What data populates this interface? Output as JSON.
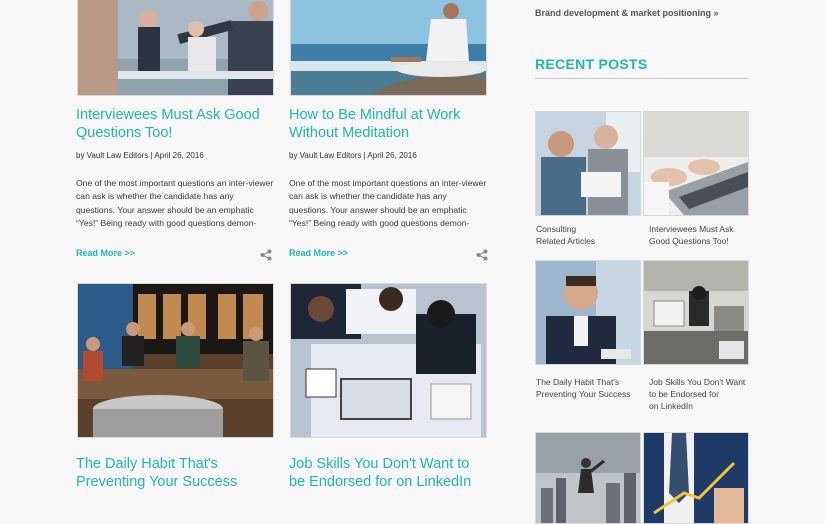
{
  "sidebar": {
    "top_link": "Brand development & market positioning »",
    "recent_heading": "RECENT POSTS",
    "recent_posts": [
      {
        "caption": "Consulting\nRelated Articles"
      },
      {
        "caption": "Interviewees Must Ask\nGood Questions Too!"
      },
      {
        "caption": "The Daily Habit That's\nPreventing Your Success"
      },
      {
        "caption": "Job Skills You Don't Want\nto be Endorsed for\non LinkedIn"
      }
    ]
  },
  "articles": [
    {
      "title": "Interviewees Must Ask Good Questions Too!",
      "byline": "by Vault Law Editors | April 26, 2016",
      "excerpt": "One of the most important questions an inter-viewer can ask is whether the candidate has any questions. Your answer should be an emphatic “Yes!” Being ready with good questions demon-",
      "read_more": "Read More >>"
    },
    {
      "title": "How to Be Mindful at Work Without Meditation",
      "byline": "by Vault Law Editors | April 26, 2016",
      "excerpt": "One of the most important questions an inter-viewer can ask is whether the candidate has any questions. Your answer should be an emphatic “Yes!” Being ready with good questions demon-",
      "read_more": "Read More >>"
    },
    {
      "title": "The Daily Habit That's Preventing Your Success"
    },
    {
      "title": "Job Skills You Don't Want to be Endorsed for on LinkedIn"
    }
  ],
  "icons": {
    "share": "share-icon"
  },
  "colors": {
    "accent": "#1fb6b4",
    "background": "#f7f7f7"
  }
}
